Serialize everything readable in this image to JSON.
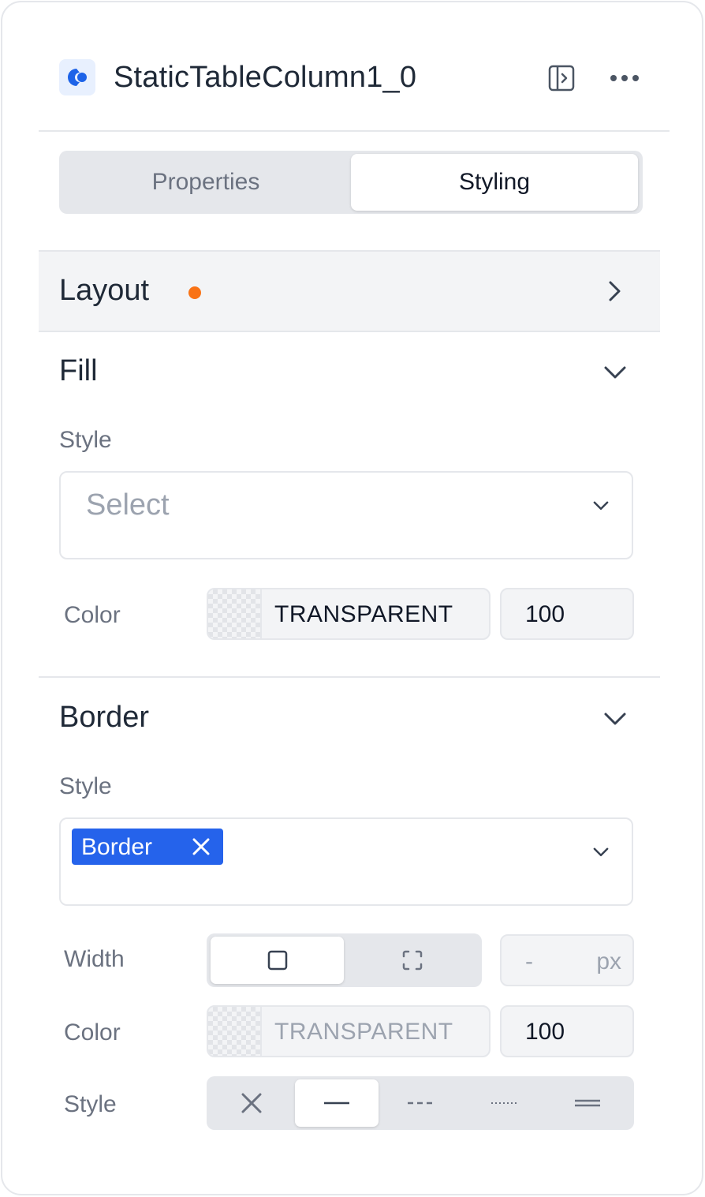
{
  "header": {
    "title": "StaticTableColumn1_0",
    "icons": [
      "app-logo-icon",
      "panel-toggle-icon",
      "more-icon"
    ]
  },
  "tabs": [
    {
      "label": "Properties",
      "selected": false
    },
    {
      "label": "Styling",
      "selected": true
    }
  ],
  "layout_section": {
    "title": "Layout",
    "modified_indicator_color": "#f97316",
    "expanded": false
  },
  "fill_section": {
    "title": "Fill",
    "style_label": "Style",
    "style_placeholder": "Select",
    "color_label": "Color",
    "color_value": "TRANSPARENT",
    "opacity": "100",
    "expanded": true
  },
  "border_section": {
    "title": "Border",
    "style_label": "Style",
    "chip_label": "Border",
    "width_label": "Width",
    "width_value": "-",
    "width_unit": "px",
    "color_label": "Color",
    "color_value": "TRANSPARENT",
    "opacity": "100",
    "line_style_label": "Style",
    "line_style_options": [
      "none",
      "solid",
      "dashed",
      "dotted",
      "double"
    ],
    "line_style_selected": "solid",
    "width_mode_options": [
      "all-sides",
      "individual-sides"
    ],
    "width_mode_selected": "all-sides",
    "expanded": true
  },
  "colors": {
    "accent": "#2563eb",
    "indicator": "#f97316"
  }
}
